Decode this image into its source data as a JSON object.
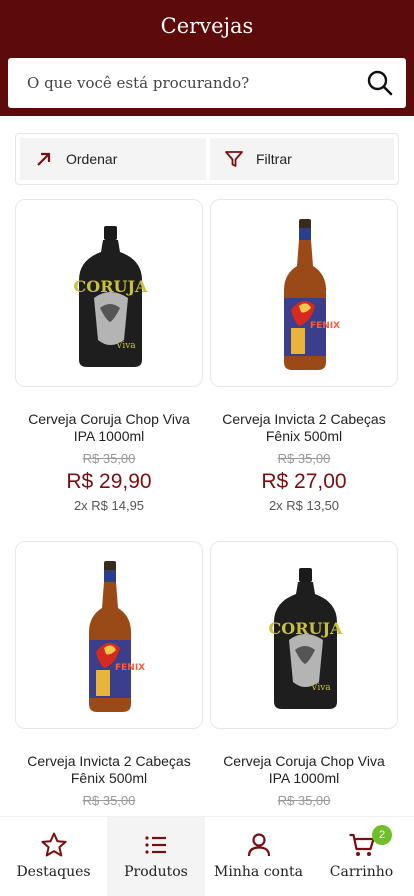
{
  "header": {
    "title": "Cervejas"
  },
  "search": {
    "placeholder": "O que você está procurando?",
    "icon": "search-icon"
  },
  "toolbar": {
    "sort_label": "Ordenar",
    "filter_label": "Filtrar"
  },
  "products": [
    {
      "name": "Cerveja Coruja Chop Viva IPA 1000ml",
      "old_price": "R$ 35,00",
      "price": "R$ 29,90",
      "installments": "2x R$ 14,95",
      "image": "black-bottle"
    },
    {
      "name": "Cerveja Invicta 2 Cabeças Fênix 500ml",
      "old_price": "R$ 35,00",
      "price": "R$ 27,00",
      "installments": "2x R$ 13,50",
      "image": "amber-bottle"
    },
    {
      "name": "Cerveja Invicta 2 Cabeças Fênix 500ml",
      "old_price": "R$ 35,00",
      "image": "amber-bottle"
    },
    {
      "name": "Cerveja Coruja Chop Viva IPA 1000ml",
      "old_price": "R$ 35,00",
      "image": "black-bottle"
    }
  ],
  "tabs": [
    {
      "label": "Destaques",
      "icon": "star-icon"
    },
    {
      "label": "Produtos",
      "icon": "list-icon",
      "active": true
    },
    {
      "label": "Minha conta",
      "icon": "user-icon"
    },
    {
      "label": "Carrinho",
      "icon": "cart-icon",
      "badge": "2"
    }
  ],
  "colors": {
    "brand": "#5c0a0a",
    "price": "#7a0f12",
    "badge": "#6fbf2a"
  }
}
